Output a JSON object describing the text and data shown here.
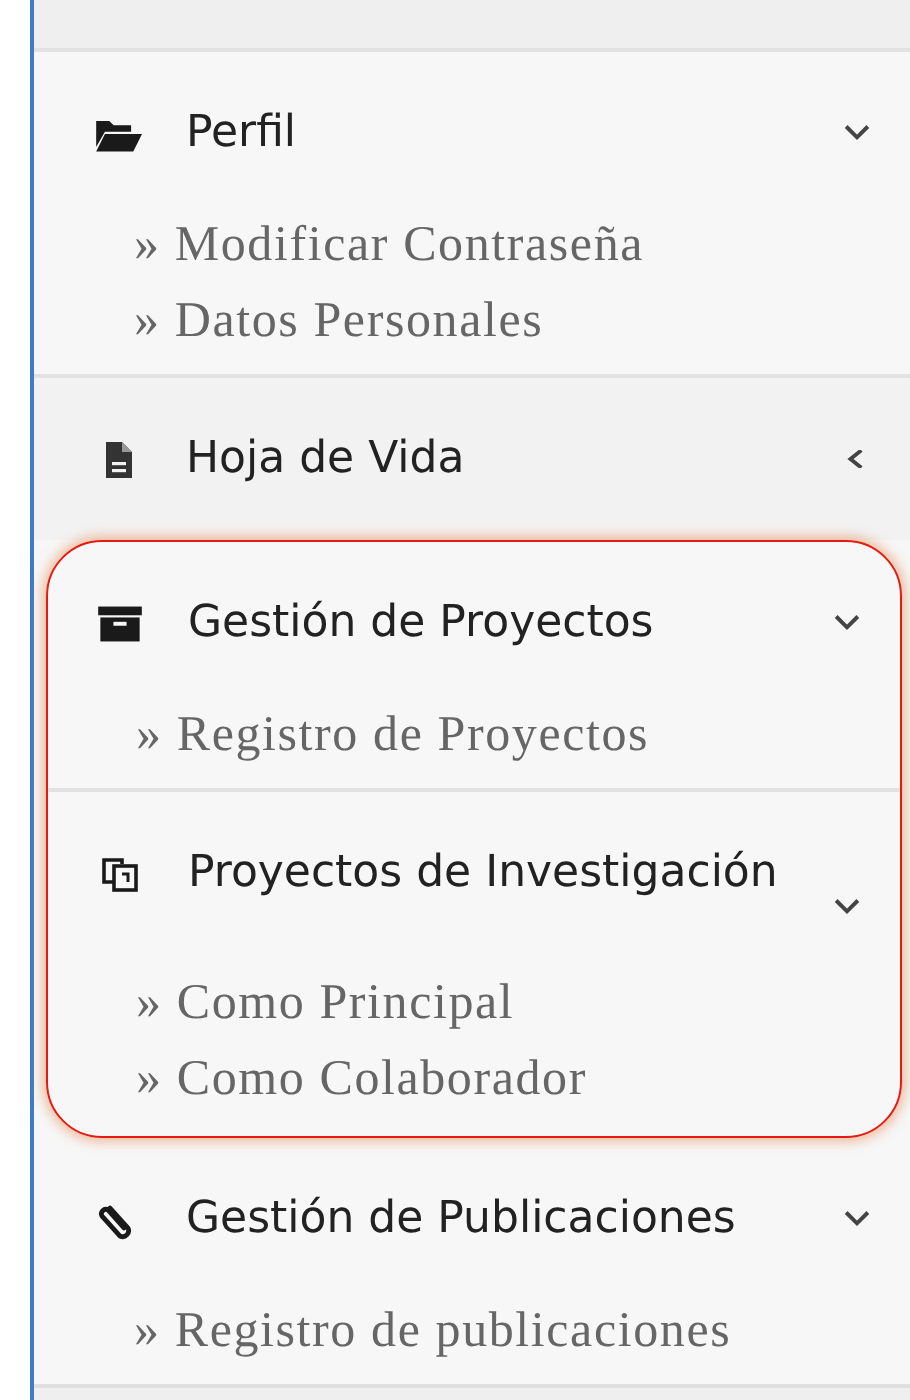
{
  "groups": [
    {
      "highlighted": false,
      "sections": [
        {
          "label": "Perfil",
          "expanded": true,
          "items": [
            "» Modificar Contraseña",
            "» Datos Personales"
          ]
        },
        {
          "label": "Hoja de Vida",
          "expanded": false
        }
      ]
    },
    {
      "highlighted": true,
      "sections": [
        {
          "label": "Gestión de Proyectos",
          "expanded": true,
          "items": [
            "» Registro de Proyectos"
          ]
        },
        {
          "label": "Proyectos de Investigación",
          "expanded": true,
          "items": [
            "» Como Principal",
            "» Como Colaborador"
          ]
        }
      ]
    },
    {
      "highlighted": false,
      "sections": [
        {
          "label": "Gestión de Publicaciones",
          "expanded": true,
          "items": [
            "» Registro de publicaciones"
          ]
        }
      ]
    }
  ]
}
